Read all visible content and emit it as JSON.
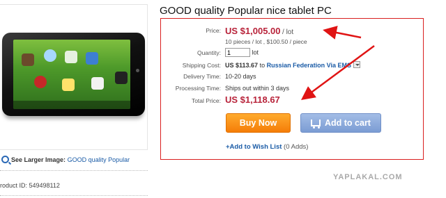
{
  "product": {
    "title": "GOOD quality Popular nice tablet PC",
    "see_larger_label": "See Larger Image:",
    "see_larger_link": "GOOD quality Popular",
    "product_id_text": "roduct ID: 549498112"
  },
  "details": {
    "price_label": "Price:",
    "price_value": "US $1,005.00",
    "price_unit": "/ lot",
    "price_sub": "10 pieces / lot , $100.50 / piece",
    "quantity_label": "Quantity:",
    "quantity_value": "1",
    "quantity_unit": "lot",
    "shipping_label": "Shipping Cost:",
    "shipping_value": "US $113.67",
    "shipping_to": "to",
    "shipping_dest": "Russian Federation Via EMS",
    "delivery_label": "Delivery Time:",
    "delivery_value": "10-20 days",
    "processing_label": "Processing Time:",
    "processing_value": "Ships out within 3 days",
    "total_label": "Total Price:",
    "total_value": "US $1,118.67"
  },
  "actions": {
    "buy_now": "Buy Now",
    "add_to_cart": "Add to cart",
    "wishlist": "+Add to Wish List",
    "wishlist_count": "(0 Adds)"
  },
  "watermark": "YAPLAKAL.COM",
  "colors": {
    "price_red": "#b8233a",
    "panel_border": "#d91e1e",
    "buy_orange": "#f57d08",
    "cart_blue": "#7b9cd3",
    "link_blue": "#1a5ba6"
  }
}
